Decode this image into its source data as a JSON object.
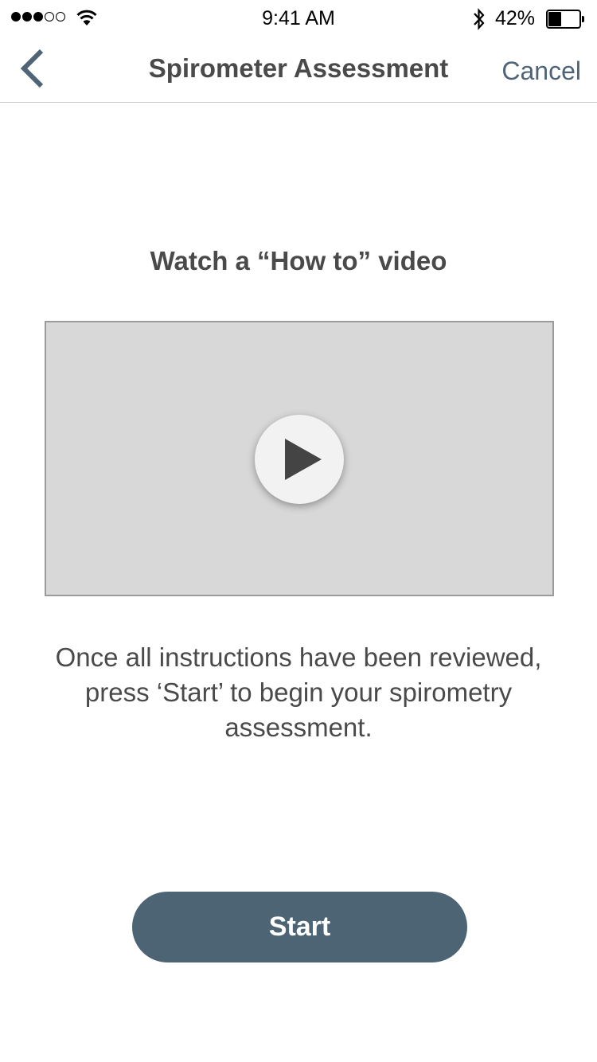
{
  "status_bar": {
    "time": "9:41 AM",
    "battery_percent": "42%",
    "battery_level": 0.42,
    "signal_bars_filled": 3,
    "signal_bars_total": 5
  },
  "nav": {
    "back_icon": "chevron-left-icon",
    "title": "Spirometer Assessment",
    "cancel_label": "Cancel"
  },
  "content": {
    "heading": "Watch a “How to” video",
    "video_icon": "play-icon",
    "instructions": "Once all instructions have been reviewed, press ‘Start’ to begin your spirometry assessment.",
    "start_label": "Start"
  },
  "colors": {
    "accent": "#4d6475",
    "text": "#4a4a4a",
    "video_bg": "#d8d8d8"
  }
}
